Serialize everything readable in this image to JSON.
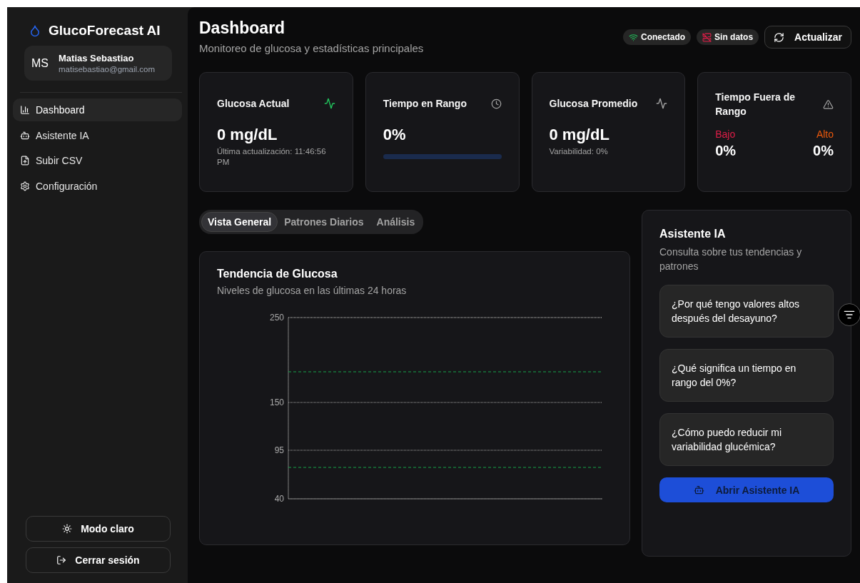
{
  "app": {
    "name": "GlucoForecast AI"
  },
  "user": {
    "initials": "MS",
    "name": "Matias Sebastiao",
    "email": "matisebastiao@gmail.com"
  },
  "nav": [
    {
      "label": "Dashboard",
      "selected": true
    },
    {
      "label": "Asistente IA",
      "selected": false
    },
    {
      "label": "Subir CSV",
      "selected": false
    },
    {
      "label": "Configuración",
      "selected": false
    }
  ],
  "sidebar_buttons": [
    "Modo claro",
    "Cerrar sesión"
  ],
  "header": {
    "title": "Dashboard",
    "subtitle": "Monitoreo de glucosa y estadísticas principales"
  },
  "status_badges": [
    {
      "label": "Conectado",
      "kind": "ok"
    },
    {
      "label": "Sin datos",
      "kind": "error"
    }
  ],
  "refresh_button": "Actualizar",
  "stats": [
    {
      "kind": "value",
      "title": "Glucosa Actual",
      "value": "0 mg/dL",
      "note": "Última actualización: 11:46:56 PM"
    },
    {
      "kind": "progress",
      "title": "Tiempo en Rango",
      "value": "0%",
      "level": 0
    },
    {
      "kind": "value",
      "title": "Glucosa Promedio",
      "value": "0 mg/dL",
      "note": "Variabilidad: 0%"
    },
    {
      "kind": "split",
      "title": "Tiempo Fuera de Rango",
      "parts": [
        {
          "label": "Bajo",
          "value": "0%",
          "color": "#e11d48"
        },
        {
          "label": "Alto",
          "value": "0%",
          "color": "#ea580c"
        }
      ]
    }
  ],
  "tabs": [
    {
      "label": "Vista General",
      "selected": true
    },
    {
      "label": "Patrones Diarios",
      "selected": false
    },
    {
      "label": "Análisis",
      "selected": false
    }
  ],
  "trend": {
    "title": "Tendencia de Glucosa",
    "subtitle": "Niveles de glucosa en las últimas 24 horas",
    "axis_labels": [
      "250",
      "150",
      "95",
      "40"
    ]
  },
  "assistant": {
    "title": "Asistente IA",
    "subtitle": "Consulta sobre tus tendencias y patrones",
    "questions": [
      "¿Por qué tengo valores altos después del desayuno?",
      "¿Qué significa un tiempo en rango del 0%?",
      "¿Cómo puedo reducir mi variabilidad glucémica?"
    ],
    "button": "Abrir Asistente IA"
  }
}
